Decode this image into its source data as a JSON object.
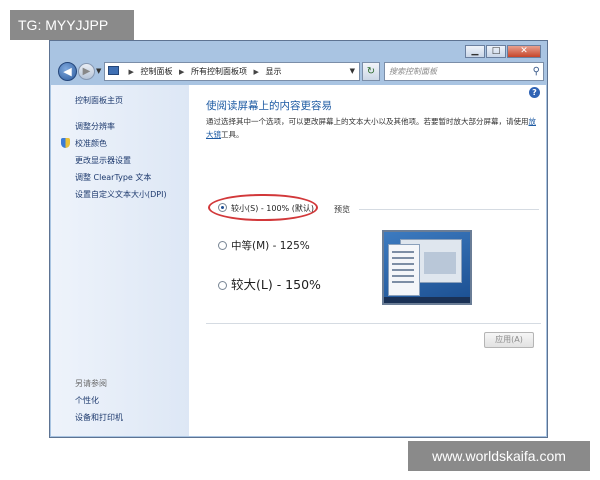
{
  "watermark_top": "TG: MYYJJPP",
  "watermark_bottom": "www.worldskaifa.com",
  "window_buttons": {
    "minimize": "▁",
    "maximize": "□",
    "close": "✕"
  },
  "navbar": {
    "back_glyph": "◀",
    "forward_glyph": "▶",
    "breadcrumb": [
      "控制面板",
      "所有控制面板项",
      "显示"
    ],
    "search_placeholder": "搜索控制面板",
    "refresh_glyph": "↻"
  },
  "sidebar": {
    "home": "控制面板主页",
    "links": [
      "调整分辨率",
      "校准颜色",
      "更改显示器设置",
      "调整 ClearType 文本",
      "设置自定义文本大小(DPI)"
    ],
    "see_also_title": "另请参阅",
    "see_also": [
      "个性化",
      "设备和打印机"
    ]
  },
  "main": {
    "title": "使阅读屏幕上的内容更容易",
    "desc_before": "通过选择其中一个选项，可以更改屏幕上的文本大小以及其他项。若要暂时放大部分屏幕，请使用",
    "desc_link": "放大镜",
    "desc_after": "工具。",
    "options": [
      {
        "label": "较小(S) - 100% (默认)",
        "checked": true
      },
      {
        "label": "中等(M) - 125%",
        "checked": false
      },
      {
        "label": "较大(L) - 150%",
        "checked": false
      }
    ],
    "preview_label": "预览",
    "apply_label": "应用(A)"
  },
  "icons": [
    "back-icon",
    "forward-icon",
    "folder-icon",
    "refresh-icon",
    "search-icon",
    "help-icon",
    "shield-icon"
  ],
  "colors": {
    "accent": "#1e5ba3",
    "highlight_oval": "#d2383a",
    "window_frame": "#a9c4e2"
  }
}
